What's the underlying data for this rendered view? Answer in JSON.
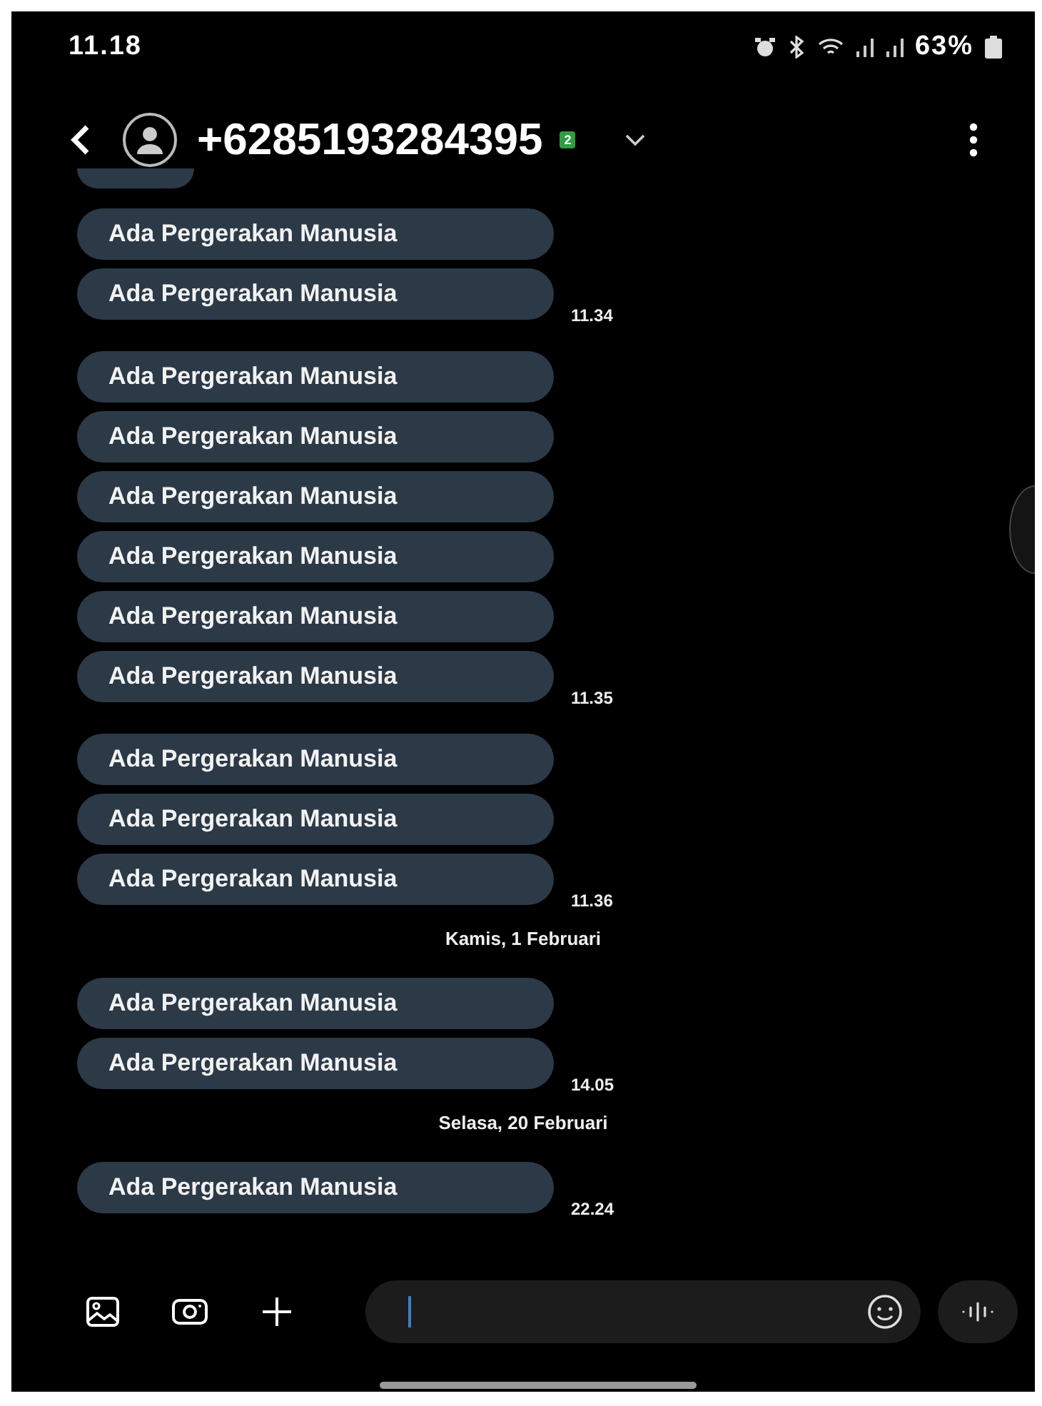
{
  "status_bar": {
    "time": "11.18",
    "battery": "63%"
  },
  "header": {
    "contact": "+6285193284395",
    "sim_badge": "2"
  },
  "messages": [
    {
      "kind": "bubble",
      "text": "Ada Pergerakan Manusia"
    },
    {
      "kind": "bubble",
      "text": "Ada Pergerakan Manusia",
      "time": "11.34"
    },
    {
      "kind": "bubble",
      "text": "Ada Pergerakan Manusia"
    },
    {
      "kind": "bubble",
      "text": "Ada Pergerakan Manusia"
    },
    {
      "kind": "bubble",
      "text": "Ada Pergerakan Manusia"
    },
    {
      "kind": "bubble",
      "text": "Ada Pergerakan Manusia"
    },
    {
      "kind": "bubble",
      "text": "Ada Pergerakan Manusia"
    },
    {
      "kind": "bubble",
      "text": "Ada Pergerakan Manusia",
      "time": "11.35"
    },
    {
      "kind": "bubble",
      "text": "Ada Pergerakan Manusia"
    },
    {
      "kind": "bubble",
      "text": "Ada Pergerakan Manusia"
    },
    {
      "kind": "bubble",
      "text": "Ada Pergerakan Manusia",
      "time": "11.36"
    },
    {
      "kind": "date",
      "text": "Kamis, 1 Februari"
    },
    {
      "kind": "bubble",
      "text": "Ada Pergerakan Manusia"
    },
    {
      "kind": "bubble",
      "text": "Ada Pergerakan Manusia",
      "time": "14.05"
    },
    {
      "kind": "date",
      "text": "Selasa, 20 Februari"
    },
    {
      "kind": "bubble",
      "text": "Ada Pergerakan Manusia",
      "time": "22.24"
    }
  ]
}
